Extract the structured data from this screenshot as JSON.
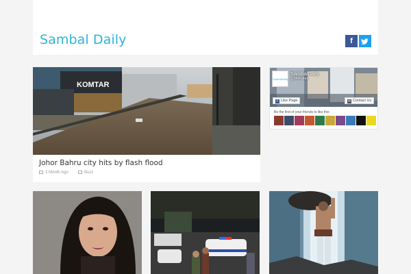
{
  "header": {
    "site_title": "Sambal Daily",
    "social": [
      {
        "icon": "facebook-icon",
        "glyph": "f",
        "color": "#3b5998"
      },
      {
        "icon": "twitter-icon",
        "glyph": "t",
        "color": "#1da1f2"
      }
    ],
    "accent_color": "#2fb4d9"
  },
  "featured": {
    "title": "Johor Bahru city hits by flash flood",
    "time": "1 Month Ago",
    "category": "Buzz",
    "image_sign": "KOMTAR"
  },
  "facebook_widget": {
    "page_name": "SambalDaily",
    "likes": "2,844 likes",
    "logo_text": "SambalDaily",
    "like_button": "Like Page",
    "contact_button": "Contact Us",
    "friends_text": "Be the first of your friends to like this"
  },
  "thumbnails": [
    {
      "icon": "portrait-photo"
    },
    {
      "icon": "police-night-photo"
    },
    {
      "icon": "waterfall-hero-photo"
    }
  ]
}
